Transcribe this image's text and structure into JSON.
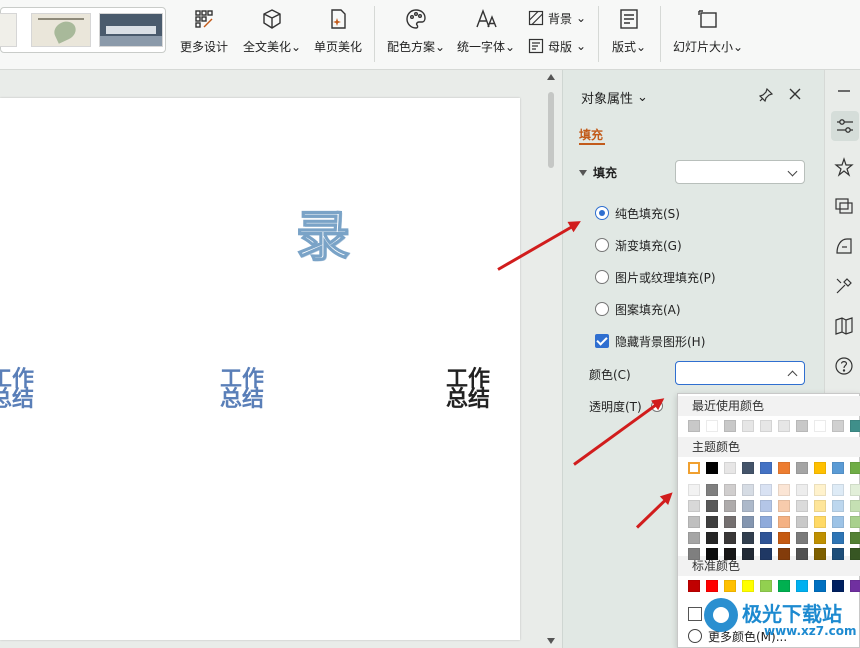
{
  "toolbar": {
    "more_design": "更多设计",
    "beautify_all": "全文美化",
    "beautify_page": "单页美化",
    "color_scheme": "配色方案",
    "unify_font": "统一字体",
    "background": "背景",
    "master": "母版",
    "layout": "版式",
    "slide_size": "幻灯片大小"
  },
  "slide": {
    "big_char": "录",
    "items": [
      {
        "line1": "工作",
        "line2": "总结"
      },
      {
        "line1": "工作",
        "line2": "总结"
      },
      {
        "line1": "工作",
        "line2": "总结"
      }
    ]
  },
  "pane": {
    "title": "对象属性",
    "tab": "填充",
    "section": "填充",
    "options": {
      "solid": "纯色填充(S)",
      "gradient": "渐变填充(G)",
      "picture": "图片或纹理填充(P)",
      "pattern": "图案填充(A)",
      "hide_bg": "隐藏背景图形(H)"
    },
    "color_label": "颜色(C)",
    "transparency_label": "透明度(T)"
  },
  "palette": {
    "recent_label": "最近使用颜色",
    "recent": [
      "#c8c8c8",
      "#ffffff",
      "#c8c8c8",
      "#e6e6e6",
      "#e6e6e6",
      "#e6e6e6",
      "#c8c8c8",
      "#ffffff",
      "#d0d0d0",
      "#3f8f8a"
    ],
    "theme_label": "主题颜色",
    "theme_top": [
      "#ffffff",
      "#000000",
      "#e7e6e6",
      "#44546a",
      "#4472c4",
      "#ed7d31",
      "#a5a5a5",
      "#ffc000",
      "#5b9bd5",
      "#70ad47"
    ],
    "theme_shades": [
      [
        "#f2f2f2",
        "#7f7f7f",
        "#d0cece",
        "#d6dce4",
        "#d9e2f3",
        "#fbe5d5",
        "#ededed",
        "#fff2cc",
        "#deebf6",
        "#e2efd9"
      ],
      [
        "#d8d8d8",
        "#595959",
        "#aeabab",
        "#adb9ca",
        "#b4c6e7",
        "#f7cbac",
        "#dbdbdb",
        "#fee599",
        "#bdd7ee",
        "#c5e0b3"
      ],
      [
        "#bfbfbf",
        "#3f3f3f",
        "#757070",
        "#8496b0",
        "#8eaadb",
        "#f4b183",
        "#c9c9c9",
        "#ffd965",
        "#9dc3e6",
        "#a8d08d"
      ],
      [
        "#a5a5a5",
        "#262626",
        "#3a3838",
        "#323f4f",
        "#2f5496",
        "#c55a11",
        "#7b7b7b",
        "#bf9000",
        "#2e75b5",
        "#538135"
      ],
      [
        "#7f7f7f",
        "#0c0c0c",
        "#171616",
        "#222a35",
        "#1f3864",
        "#833c0b",
        "#525252",
        "#7f6000",
        "#1e4e79",
        "#375623"
      ]
    ],
    "standard_label": "标准颜色",
    "standard": [
      "#c00000",
      "#ff0000",
      "#ffc000",
      "#ffff00",
      "#92d050",
      "#00b050",
      "#00b0f0",
      "#0070c0",
      "#002060",
      "#7030a0"
    ],
    "auto_label": "自动",
    "more_colors_label": "更多颜色(M)..."
  },
  "watermark": {
    "title": "极光下载站",
    "url": "www.xz7.com"
  },
  "colors": {
    "accent": "#c25b1b",
    "selection_blue": "#2f6fd0",
    "arrow_red": "#d11d1d"
  }
}
